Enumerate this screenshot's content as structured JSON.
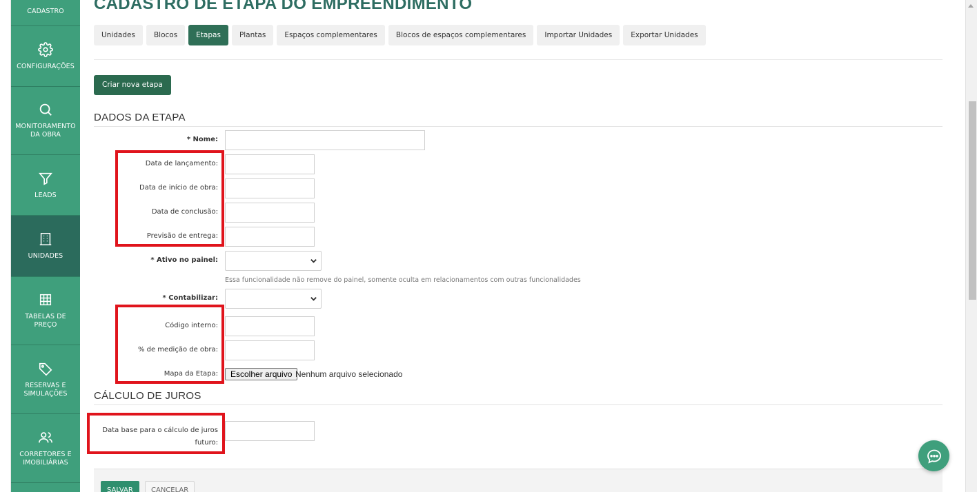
{
  "page": {
    "title": "CADASTRO DE ETAPA DO EMPREENDIMENTO"
  },
  "sidebar": {
    "items": [
      {
        "label": "CADASTRO",
        "icon": "unknown-icon"
      },
      {
        "label": "CONFIGURAÇÕES",
        "icon": "gear-icon"
      },
      {
        "label": "MONITORAMENTO DA OBRA",
        "icon": "search-icon"
      },
      {
        "label": "LEADS",
        "icon": "funnel-icon"
      },
      {
        "label": "UNIDADES",
        "icon": "building-icon"
      },
      {
        "label": "TABELAS DE PREÇO",
        "icon": "grid-icon"
      },
      {
        "label": "RESERVAS E SIMULAÇÕES",
        "icon": "tag-icon"
      },
      {
        "label": "CORRETORES E IMOBILIÁRIAS",
        "icon": "users-icon"
      }
    ],
    "active": "UNIDADES",
    "color": "#3f9f7c",
    "active_color": "#2b6b5c"
  },
  "tabs": [
    {
      "label": "Unidades"
    },
    {
      "label": "Blocos"
    },
    {
      "label": "Etapas"
    },
    {
      "label": "Plantas"
    },
    {
      "label": "Espaços complementares"
    },
    {
      "label": "Blocos de espaços complementares"
    },
    {
      "label": "Importar Unidades"
    },
    {
      "label": "Exportar Unidades"
    }
  ],
  "active_tab": "Etapas",
  "actions": {
    "create_label": "Criar nova etapa"
  },
  "sections": {
    "dados": "DADOS DA ETAPA",
    "juros": "CÁLCULO DE JUROS"
  },
  "form": {
    "nome": {
      "label": "* Nome:",
      "value": ""
    },
    "data_lancamento": {
      "label": "Data de lançamento:",
      "value": ""
    },
    "data_inicio_obra": {
      "label": "Data de início de obra:",
      "value": ""
    },
    "data_conclusao": {
      "label": "Data de conclusão:",
      "value": ""
    },
    "previsao_entrega": {
      "label": "Previsão de entrega:",
      "value": ""
    },
    "ativo_painel": {
      "label": "* Ativo no painel:",
      "value": "",
      "help": "Essa funcionalidade não remove do painel, somente oculta em relacionamentos com outras funcionalidades"
    },
    "contabilizar": {
      "label": "* Contabilizar:",
      "value": ""
    },
    "codigo_interno": {
      "label": "Código interno:",
      "value": ""
    },
    "medicao_obra": {
      "label": "% de medição de obra:",
      "value": ""
    },
    "mapa_etapa": {
      "label": "Mapa da Etapa:",
      "button": "Escolher arquivo",
      "status": "Nenhum arquivo selecionado"
    },
    "data_base_juros": {
      "label": "Data base para o cálculo de juros futuro:",
      "value": ""
    }
  },
  "footer": {
    "save": "SALVAR",
    "cancel": "CANCELAR"
  },
  "chat": {
    "icon": "chat-bubble-icon"
  },
  "colors": {
    "title": "#2e6d62",
    "primary": "#2b6a4f",
    "highlight": "#e0141c"
  }
}
